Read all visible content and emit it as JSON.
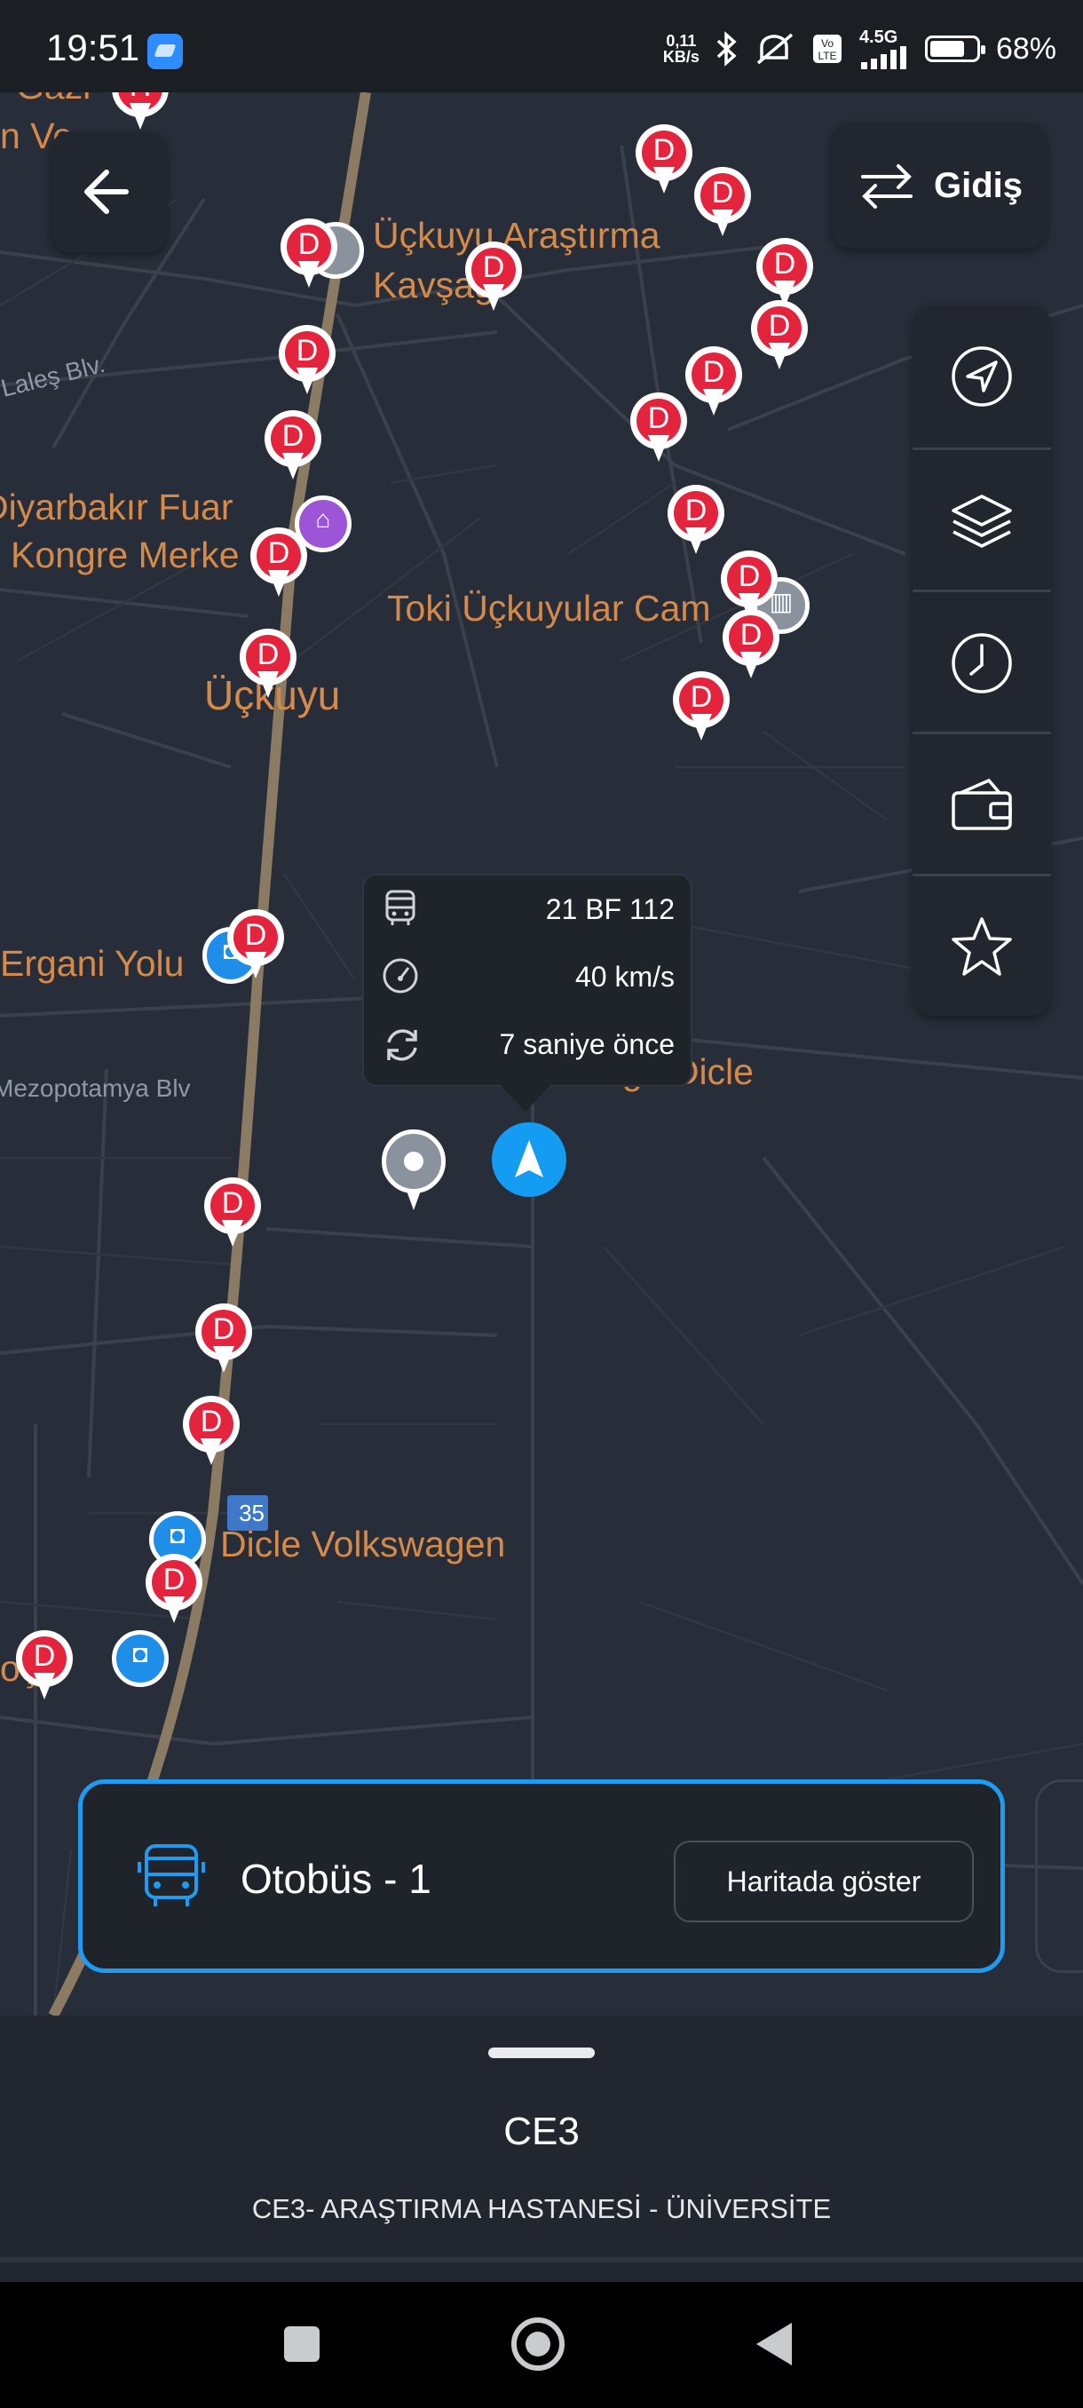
{
  "status_bar": {
    "time": "19:51",
    "net_speed_value": "0,11",
    "net_speed_unit": "KB/s",
    "network": "4.5G",
    "battery": "68%"
  },
  "map": {
    "labels": {
      "place1_a": "Üçkuyu Araştırma",
      "place1_b": "Kavşağı",
      "fair_a": "Diyarbakır Fuar",
      "fair_b": "Kongre Merke",
      "toki": "Toki Üçkuyular Cam",
      "district": "Üçkuyu",
      "ergani": "Ergani Yolu",
      "kargo": "Yurtiçi Kargo Dicle",
      "volks": "Dicle Volkswagen",
      "partial_left1": "Gazi",
      "partial_left2": "n Ve",
      "partial_left3": "oç",
      "street_lales": "Laleş Blv.",
      "street_mezo": "Mezopotamya Blv",
      "shield": "35"
    },
    "stop_letter": "D",
    "hospital_letter": "H"
  },
  "buttons": {
    "direction_label": "Gidiş"
  },
  "toolbar_icons": [
    "navigate-icon",
    "layers-icon",
    "clock-icon",
    "wallet-icon",
    "star-icon"
  ],
  "bus_info": {
    "plate": "21 BF 112",
    "speed": "40 km/s",
    "updated": "7 saniye önce"
  },
  "vehicle_card": {
    "title": "Otobüs - 1",
    "show_button": "Haritada göster"
  },
  "route": {
    "code": "CE3",
    "name": "CE3- ARAŞTIRMA HASTANESİ - ÜNİVERSİTE"
  },
  "colors": {
    "accent": "#1e9cf4",
    "stop_red": "#e4233c",
    "label_orange": "#d58a4a",
    "map_bg": "#282e39"
  }
}
